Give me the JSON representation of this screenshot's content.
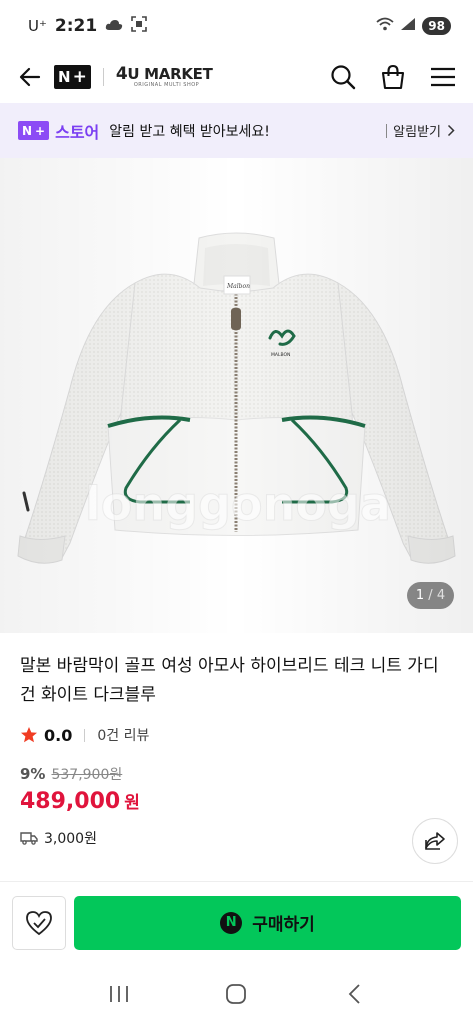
{
  "status_bar": {
    "carrier": "U⁺",
    "time": "2:21",
    "battery": "98"
  },
  "header": {
    "npay_n": "N",
    "npay_plus": "+",
    "market_four": "4",
    "market_name": "U MARKET",
    "market_sub": "ORIGINAL MULTI SHOP"
  },
  "banner": {
    "store_n": "N",
    "store_plus": "+",
    "store_label": "스토어",
    "message": "알림 받고 혜택 받아보세요!",
    "action": "알림받기"
  },
  "gallery": {
    "current": "1",
    "separator": " / ",
    "total": "4",
    "watermark": "longgonoga",
    "brand_tag": "Malbon",
    "chest_brand": "MALBON"
  },
  "product": {
    "title": "말본 바람막이 골프 여성 아모사 하이브리드 테크 니트 가디건 화이트 다크블루",
    "rating": "0.0",
    "reviews": "0건 리뷰",
    "discount": "9%",
    "original_price": "537,900원",
    "price": "489,000",
    "price_unit": "원",
    "shipping": "3,000원"
  },
  "purchase": {
    "buy_n": "N",
    "buy_label": "구매하기"
  },
  "colors": {
    "brand_green": "#03c75a",
    "price_red": "#e0143c",
    "store_purple": "#8c4cf5",
    "banner_bg": "#f1eefb",
    "jacket_trim": "#1f6b47"
  }
}
